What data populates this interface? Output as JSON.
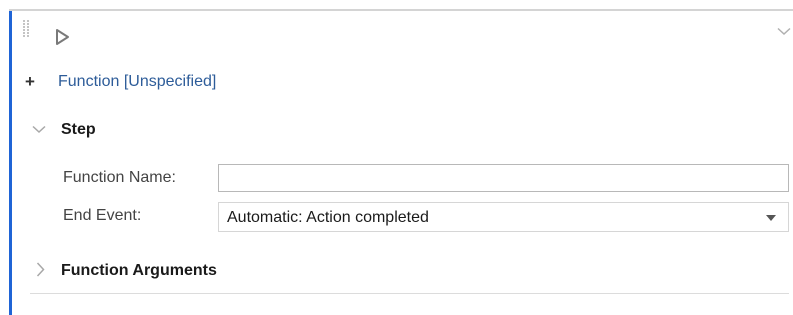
{
  "panel": {
    "add_icon": "plus-icon",
    "function_title": "Function [Unspecified]",
    "run_icon": "play-icon",
    "collapse_icon": "chevron-down-icon",
    "accent_color": "#1f64d6",
    "link_color": "#2d5c99"
  },
  "step_section": {
    "title": "Step",
    "expanded": true,
    "fields": {
      "function_name": {
        "label": "Function Name:",
        "value": "",
        "placeholder": ""
      },
      "end_event": {
        "label": "End Event:",
        "selected": "Automatic: Action completed"
      }
    }
  },
  "arguments_section": {
    "title": "Function Arguments",
    "expanded": false
  }
}
